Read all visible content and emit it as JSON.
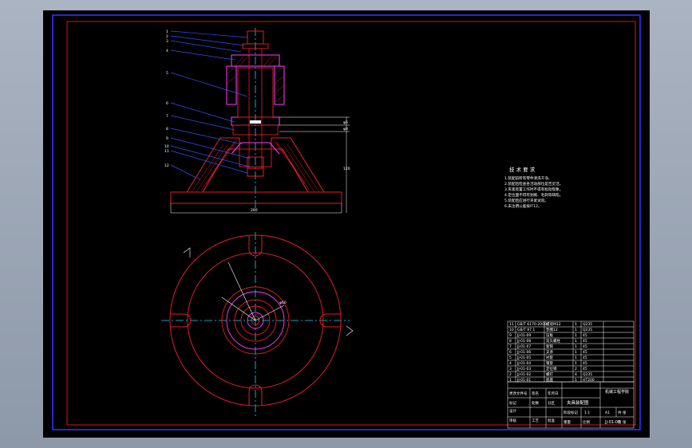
{
  "colors": {
    "background": "#000000",
    "border": "#d01818",
    "frame": "#3030ff",
    "part_red": "#e02020",
    "part_magenta": "#ff40ff",
    "centerline": "#20d0ff",
    "leader": "#ffffff"
  },
  "notes": {
    "title": "技 术 要 求",
    "lines": [
      "1.装配前所有零件清洗干净。",
      "2.装配后检查各活动部位是否灵活。",
      "3.夹紧装置工作时不得有松动现象。",
      "4.定位面不得有划痕、毛刺等缺陷。",
      "5.装配后应进行夹紧试验。",
      "6.未注明公差按IT12。"
    ]
  },
  "balloons": [
    "1",
    "2",
    "3",
    "4",
    "5",
    "6",
    "7",
    "8",
    "9",
    "10",
    "11",
    "12"
  ],
  "dimensions": [
    "φ6",
    "φ8",
    "120",
    "280",
    "φ60"
  ],
  "title_block": {
    "bom_rows": [
      [
        "11",
        "GB/T 6170-2000",
        "螺母M12",
        "1",
        "Q235"
      ],
      [
        "10",
        "GB/T 97.1",
        "垫圈12",
        "1",
        "Q235"
      ],
      [
        "9",
        "JJ-01-09",
        "压板",
        "1",
        "45"
      ],
      [
        "8",
        "JJ-01-08",
        "双头螺柱",
        "1",
        "45"
      ],
      [
        "7",
        "JJ-01-07",
        "套筒",
        "1",
        "45"
      ],
      [
        "6",
        "JJ-01-06",
        "支承",
        "1",
        "45"
      ],
      [
        "5",
        "JJ-01-05",
        "衬套",
        "1",
        "45"
      ],
      [
        "4",
        "JJ-01-04",
        "锥套",
        "1",
        "45"
      ],
      [
        "3",
        "JJ-01-03",
        "定位销",
        "2",
        "45"
      ],
      [
        "2",
        "JJ-01-02",
        "螺钉",
        "4",
        "Q235"
      ],
      [
        "1",
        "JJ-01-01",
        "底座",
        "1",
        "HT200"
      ]
    ],
    "school": "机械工程学院",
    "drawing_name": "夹具装配图",
    "drawing_number": "JJ-01-00",
    "scale": "1:1",
    "sheet": "A1",
    "labels": [
      "设计",
      "审核",
      "工艺",
      "批准",
      "标记",
      "处数",
      "分区",
      "更改文件号",
      "签名",
      "年月日",
      "阶段标记",
      "重量",
      "比例",
      "共 张",
      "第 张"
    ]
  }
}
